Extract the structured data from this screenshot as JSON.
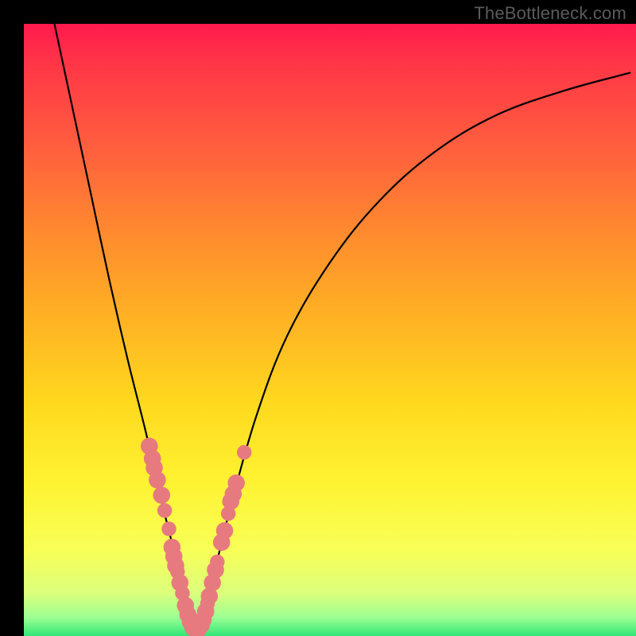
{
  "watermark": "TheBottleneck.com",
  "chart_data": {
    "type": "line",
    "title": "",
    "xlabel": "",
    "ylabel": "",
    "xlim": [
      0,
      100
    ],
    "ylim": [
      0,
      100
    ],
    "grid": false,
    "legend": false,
    "series": [
      {
        "name": "bottleneck-curve",
        "color": "#000000",
        "x": [
          5,
          8,
          11,
          14,
          17,
          20,
          22,
          24,
          25.5,
          26.5,
          27.5,
          28,
          29,
          31,
          34,
          38,
          43,
          50,
          58,
          67,
          77,
          88,
          99
        ],
        "y": [
          100,
          86,
          72,
          58,
          45,
          33,
          24,
          16,
          10,
          6,
          3,
          1,
          3,
          10,
          22,
          36,
          49,
          61,
          71,
          79,
          85,
          89,
          92
        ]
      }
    ],
    "annotations": {
      "dots_color": "#e77a7f",
      "dots": [
        {
          "x": 20.5,
          "y": 31,
          "r": 1.4
        },
        {
          "x": 21.0,
          "y": 29,
          "r": 1.4
        },
        {
          "x": 21.3,
          "y": 27.5,
          "r": 1.4
        },
        {
          "x": 21.8,
          "y": 25.5,
          "r": 1.4
        },
        {
          "x": 22.5,
          "y": 23,
          "r": 1.4
        },
        {
          "x": 23.0,
          "y": 20.5,
          "r": 1.2
        },
        {
          "x": 23.7,
          "y": 17.5,
          "r": 1.2
        },
        {
          "x": 24.2,
          "y": 14.5,
          "r": 1.4
        },
        {
          "x": 24.5,
          "y": 13,
          "r": 1.4
        },
        {
          "x": 24.8,
          "y": 11.5,
          "r": 1.4
        },
        {
          "x": 25.1,
          "y": 10.5,
          "r": 1.2
        },
        {
          "x": 25.5,
          "y": 8.7,
          "r": 1.4
        },
        {
          "x": 25.9,
          "y": 7.0,
          "r": 1.2
        },
        {
          "x": 26.4,
          "y": 5.0,
          "r": 1.4
        },
        {
          "x": 26.8,
          "y": 3.5,
          "r": 1.4
        },
        {
          "x": 27.2,
          "y": 2.3,
          "r": 1.4
        },
        {
          "x": 27.6,
          "y": 1.4,
          "r": 1.4
        },
        {
          "x": 28.0,
          "y": 1.0,
          "r": 1.4
        },
        {
          "x": 28.5,
          "y": 1.1,
          "r": 1.4
        },
        {
          "x": 29.0,
          "y": 1.8,
          "r": 1.4
        },
        {
          "x": 29.3,
          "y": 2.7,
          "r": 1.4
        },
        {
          "x": 29.7,
          "y": 4.0,
          "r": 1.4
        },
        {
          "x": 30.0,
          "y": 5.3,
          "r": 1.2
        },
        {
          "x": 30.3,
          "y": 6.5,
          "r": 1.4
        },
        {
          "x": 30.8,
          "y": 8.7,
          "r": 1.4
        },
        {
          "x": 31.3,
          "y": 10.8,
          "r": 1.4
        },
        {
          "x": 31.6,
          "y": 12.1,
          "r": 1.2
        },
        {
          "x": 32.3,
          "y": 15.3,
          "r": 1.4
        },
        {
          "x": 32.8,
          "y": 17.2,
          "r": 1.4
        },
        {
          "x": 33.4,
          "y": 20.0,
          "r": 1.2
        },
        {
          "x": 33.8,
          "y": 22.0,
          "r": 1.4
        },
        {
          "x": 34.2,
          "y": 23.2,
          "r": 1.4
        },
        {
          "x": 34.7,
          "y": 25.0,
          "r": 1.4
        },
        {
          "x": 36.0,
          "y": 30.0,
          "r": 1.2
        }
      ]
    }
  }
}
